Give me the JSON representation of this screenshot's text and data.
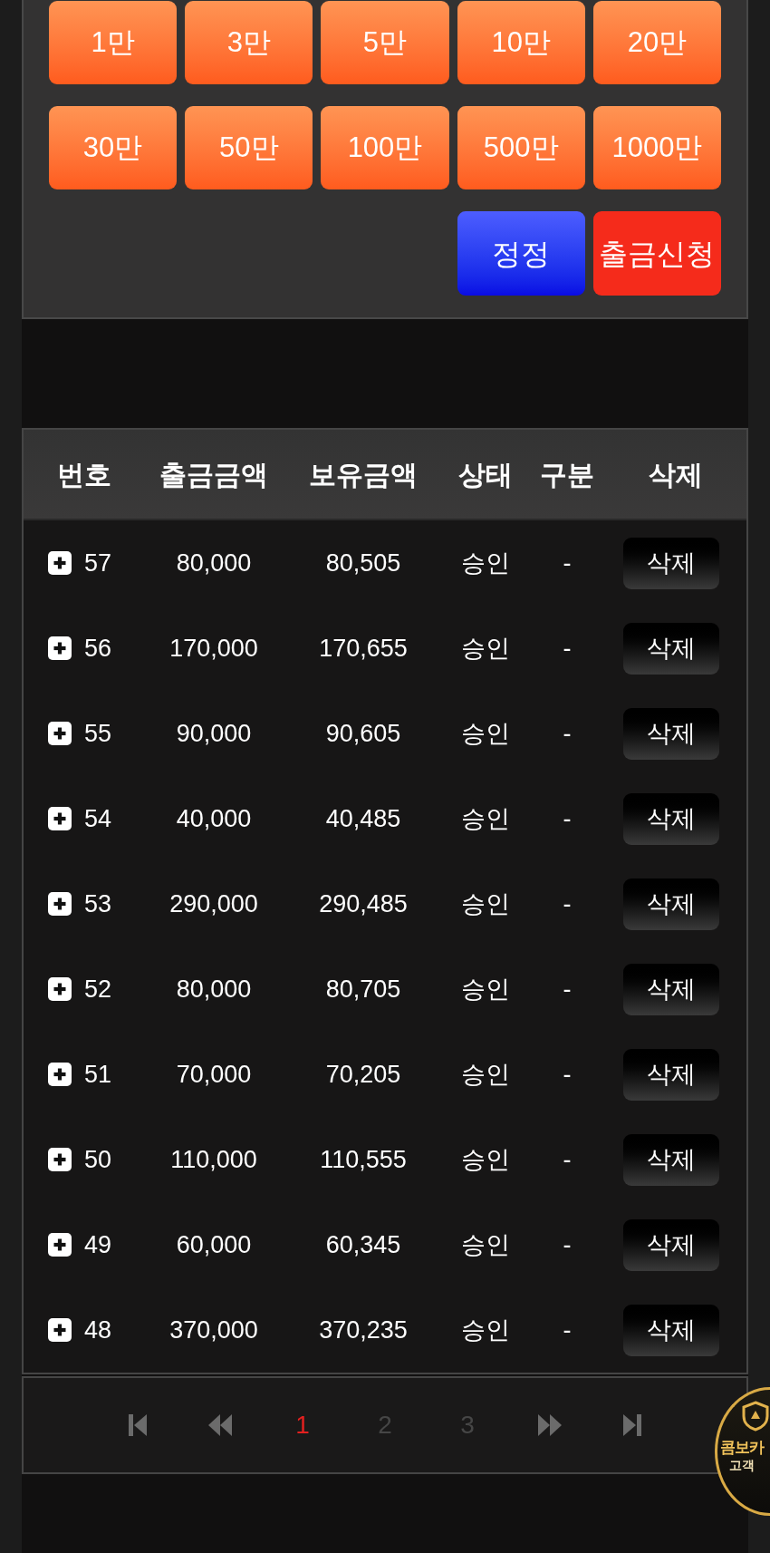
{
  "amount_buttons": [
    "1만",
    "3만",
    "5만",
    "10만",
    "20만",
    "30만",
    "50만",
    "100만",
    "500만",
    "1000만"
  ],
  "action_buttons": [
    {
      "kind": "reset",
      "label": "정정"
    },
    {
      "kind": "submit",
      "label": "출금신청"
    }
  ],
  "table": {
    "columns": [
      "번호",
      "출금금액",
      "보유금액",
      "상태",
      "구분",
      "삭제"
    ],
    "rows": [
      {
        "expanded": false,
        "number": "57",
        "withdrawal_amount": "80,000",
        "balance": "80,505",
        "status": "승인",
        "category": "-",
        "action": "삭제"
      },
      {
        "expanded": false,
        "number": "56",
        "withdrawal_amount": "170,000",
        "balance": "170,655",
        "status": "승인",
        "category": "-",
        "action": "삭제"
      },
      {
        "expanded": false,
        "number": "55",
        "withdrawal_amount": "90,000",
        "balance": "90,605",
        "status": "승인",
        "category": "-",
        "action": "삭제"
      },
      {
        "expanded": false,
        "number": "54",
        "withdrawal_amount": "40,000",
        "balance": "40,485",
        "status": "승인",
        "category": "-",
        "action": "삭제"
      },
      {
        "expanded": false,
        "number": "53",
        "withdrawal_amount": "290,000",
        "balance": "290,485",
        "status": "승인",
        "category": "-",
        "action": "삭제"
      },
      {
        "expanded": false,
        "number": "52",
        "withdrawal_amount": "80,000",
        "balance": "80,705",
        "status": "승인",
        "category": "-",
        "action": "삭제"
      },
      {
        "expanded": false,
        "number": "51",
        "withdrawal_amount": "70,000",
        "balance": "70,205",
        "status": "승인",
        "category": "-",
        "action": "삭제"
      },
      {
        "expanded": false,
        "number": "50",
        "withdrawal_amount": "110,000",
        "balance": "110,555",
        "status": "승인",
        "category": "-",
        "action": "삭제"
      },
      {
        "expanded": false,
        "number": "49",
        "withdrawal_amount": "60,000",
        "balance": "60,345",
        "status": "승인",
        "category": "-",
        "action": "삭제"
      },
      {
        "expanded": false,
        "number": "48",
        "withdrawal_amount": "370,000",
        "balance": "370,235",
        "status": "승인",
        "category": "-",
        "action": "삭제"
      }
    ]
  },
  "pagination": {
    "pages": [
      {
        "label": "1",
        "selected": true
      },
      {
        "label": "2",
        "selected": false
      },
      {
        "label": "3",
        "selected": false
      }
    ]
  },
  "floating_badge": {
    "title": "콤보카",
    "subtitle": "고객"
  }
}
